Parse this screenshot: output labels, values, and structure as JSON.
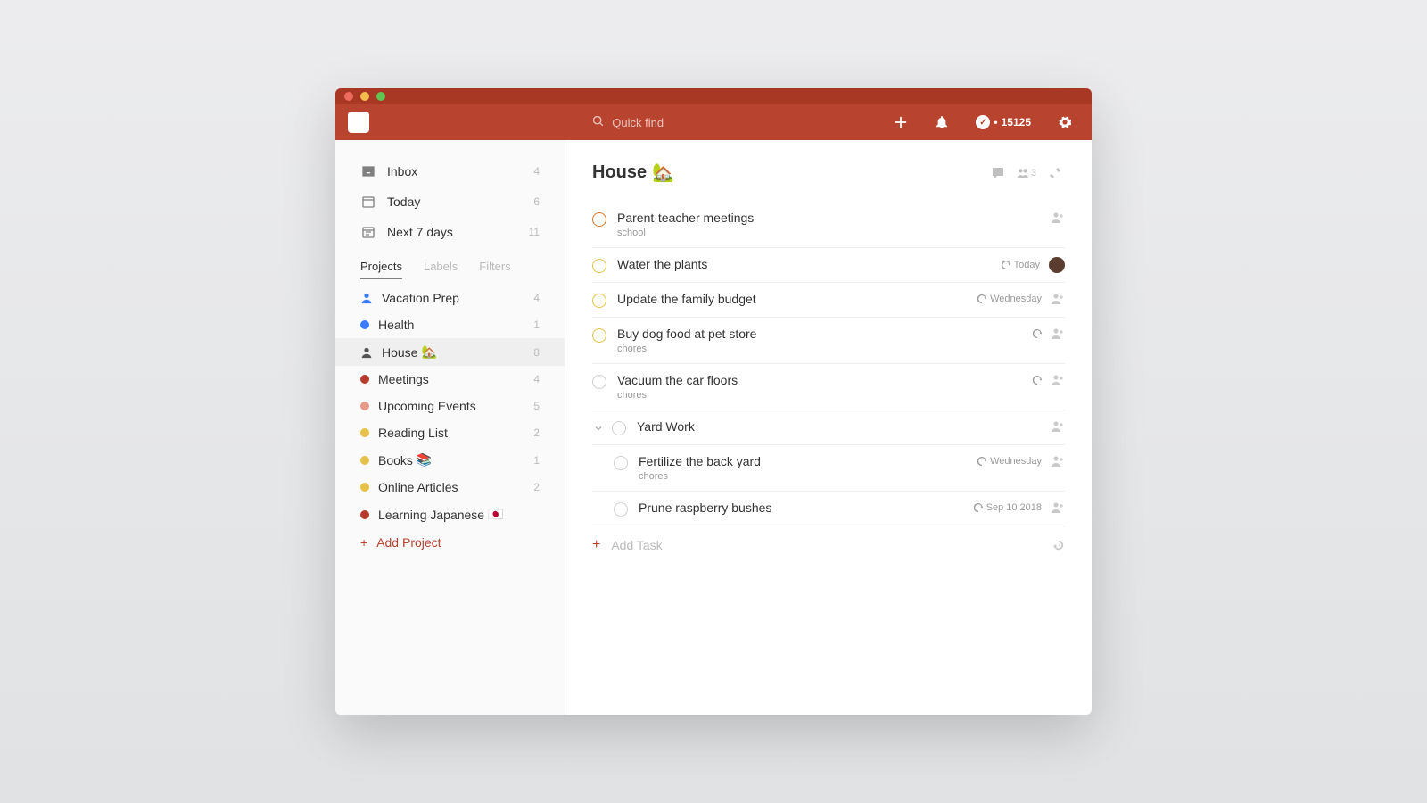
{
  "header": {
    "search_placeholder": "Quick find",
    "karma_points": "15125"
  },
  "sidebar": {
    "inbox_label": "Inbox",
    "inbox_count": "4",
    "today_label": "Today",
    "today_count": "6",
    "next7_label": "Next 7 days",
    "next7_count": "11",
    "tabs": {
      "projects": "Projects",
      "labels": "Labels",
      "filters": "Filters"
    },
    "projects": [
      {
        "name": "Vacation Prep",
        "count": "4",
        "color": "#3b7cff",
        "icon": "person"
      },
      {
        "name": "Health",
        "count": "1",
        "color": "#3b7cff",
        "icon": "dot"
      },
      {
        "name": "House",
        "emoji": "🏡",
        "count": "8",
        "color": "",
        "icon": "person",
        "selected": true
      },
      {
        "name": "Meetings",
        "count": "4",
        "color": "#b83a2a",
        "icon": "dot"
      },
      {
        "name": "Upcoming Events",
        "count": "5",
        "color": "#e89a8a",
        "icon": "dot"
      },
      {
        "name": "Reading List",
        "count": "2",
        "color": "#e6c24a",
        "icon": "dot"
      },
      {
        "name": "Books",
        "emoji": "📚",
        "count": "1",
        "color": "#e6c24a",
        "icon": "dot"
      },
      {
        "name": "Online Articles",
        "count": "2",
        "color": "#e6c24a",
        "icon": "dot"
      },
      {
        "name": "Learning Japanese",
        "emoji": "🇯🇵",
        "count": "",
        "color": "#b83a2a",
        "icon": "dot"
      }
    ],
    "add_project": "Add Project"
  },
  "main": {
    "title": "House",
    "title_emoji": "🏡",
    "share_count": "3",
    "tasks": [
      {
        "title": "Parent-teacher meetings",
        "meta": "school",
        "priority": "orange",
        "due": "",
        "sub": false
      },
      {
        "title": "Water the plants",
        "meta": "",
        "priority": "yellow",
        "due": "Today",
        "avatar": true,
        "sub": false
      },
      {
        "title": "Update the family budget",
        "meta": "",
        "priority": "yellow",
        "due": "Wednesday",
        "sub": false
      },
      {
        "title": "Buy dog food at pet store",
        "meta": "chores",
        "priority": "yellow",
        "due": "",
        "recurring": true,
        "sub": false
      },
      {
        "title": "Vacuum the car floors",
        "meta": "chores",
        "priority": "none",
        "due": "",
        "recurring": true,
        "sub": false
      },
      {
        "title": "Yard Work",
        "meta": "",
        "priority": "none",
        "due": "",
        "section": true,
        "expanded": true,
        "sub": false
      },
      {
        "title": "Fertilize the back yard",
        "meta": "chores",
        "priority": "none",
        "due": "Wednesday",
        "sub": true
      },
      {
        "title": "Prune raspberry bushes",
        "meta": "",
        "priority": "none",
        "due": "Sep 10 2018",
        "sub": true
      }
    ],
    "add_task": "Add Task"
  }
}
